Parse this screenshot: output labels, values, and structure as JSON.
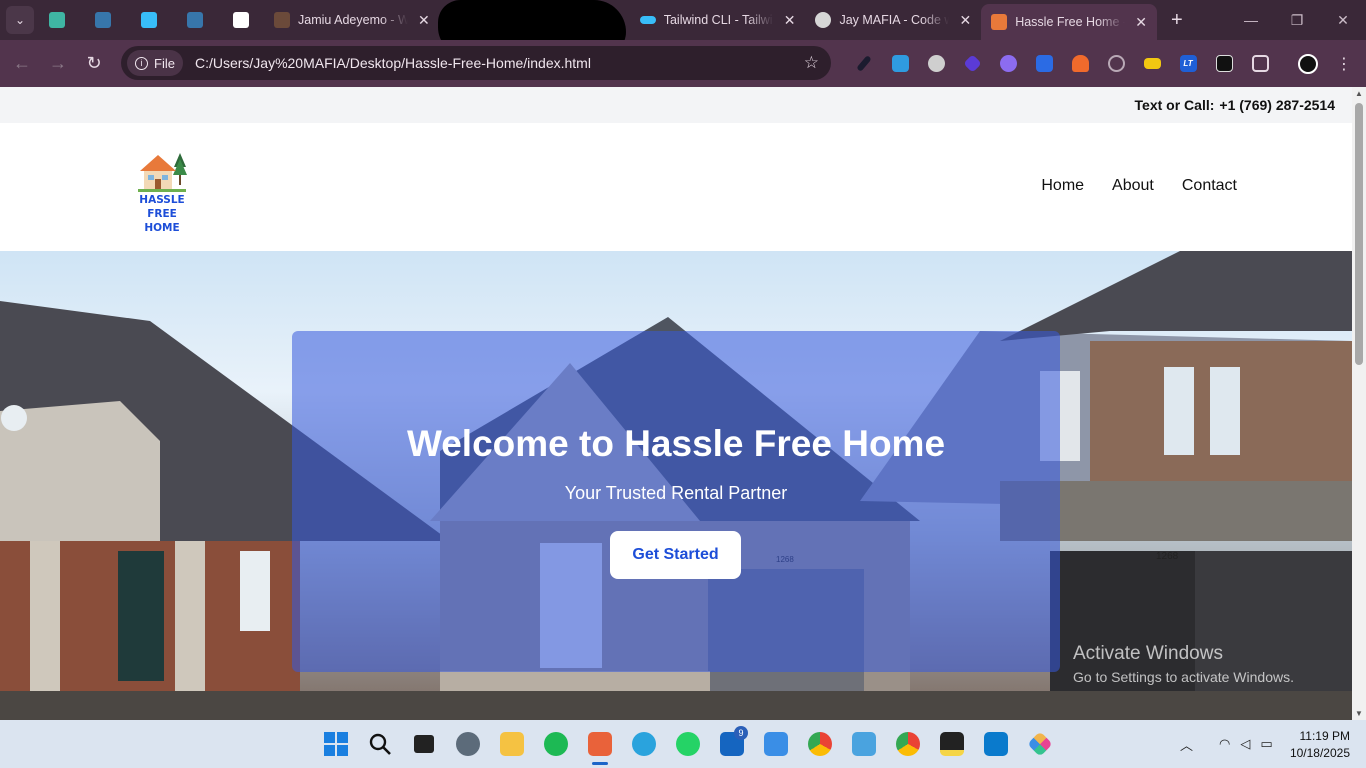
{
  "browser": {
    "tabs": [
      {
        "title": "",
        "kind": "tab-list"
      },
      {
        "title": "",
        "kind": "pinned",
        "color": "#3fb5a3"
      },
      {
        "title": "",
        "kind": "pinned",
        "color": "#3776ab"
      },
      {
        "title": "",
        "kind": "pinned",
        "color": "#38bdf8"
      },
      {
        "title": "",
        "kind": "pinned",
        "color": "#3776ab"
      },
      {
        "title": "",
        "kind": "pinned",
        "color": "#ffffff"
      },
      {
        "title": "Jamiu Adeyemo - W",
        "kind": "tab"
      },
      {
        "title": "Tailwind CLI - Tailwi",
        "kind": "tab"
      },
      {
        "title": "Jay MAFIA - Code w",
        "kind": "tab"
      },
      {
        "title": "Hassle Free Home -",
        "kind": "tab",
        "active": true
      }
    ],
    "new_tab_symbol": "+",
    "address_chip": "File",
    "url": "C:/Users/Jay%20MAFIA/Desktop/Hassle-Free-Home/index.html",
    "extension_icons": [
      "eyedropper-icon",
      "ghost-icon",
      "database-icon",
      "cube-icon",
      "gear-icon",
      "translate-icon",
      "rocket-icon",
      "compass-icon",
      "tag-icon",
      "lt-icon",
      "shirt-icon",
      "puzzle-icon",
      "profile-icon",
      "more-icon"
    ],
    "extension_labels": {
      "lt": "LT"
    }
  },
  "site": {
    "contact_label": "Text or Call:",
    "phone": "+1 (769) 287-2514",
    "logo_line1": "HASSLE FREE",
    "logo_line2": "HOME",
    "nav": [
      "Home",
      "About",
      "Contact"
    ],
    "hero_title": "Welcome to Hassle Free Home",
    "hero_subtitle": "Your Trusted Rental Partner",
    "cta": "Get Started",
    "house_number_left": "1268",
    "house_number_right": "1268"
  },
  "watermark": {
    "line1": "Activate Windows",
    "line2": "Go to Settings to activate Windows."
  },
  "taskbar": {
    "apps": [
      "windows-start",
      "search",
      "task-view",
      "settings",
      "file-explorer",
      "spotify",
      "snipping-tool",
      "telegram",
      "whatsapp",
      "outlook",
      "photos",
      "chrome",
      "notepad",
      "chrome-profile",
      "sticky-notes",
      "vscode",
      "git"
    ],
    "outlook_badge": "9",
    "time": "11:19 PM",
    "date": "10/18/2025"
  }
}
